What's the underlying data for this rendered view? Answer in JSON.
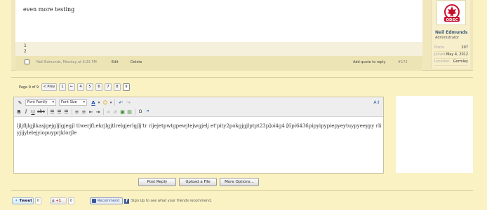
{
  "post": {
    "message": "even more testing",
    "code_lines": [
      "1",
      "2"
    ],
    "author_time": "Neil Edmunds, Monday at 6:23 PM",
    "edit_label": "Edit",
    "delete_label": "Delete",
    "quote_label": "Add quote to reply",
    "post_number": "#172"
  },
  "author": {
    "avatar_text": "ODSC",
    "name": "Neil Edmunds",
    "role": "Administrator",
    "stats": [
      {
        "label": "Posts:",
        "value": "207"
      },
      {
        "label": "Joined:",
        "value": "May 4, 2012"
      },
      {
        "label": "Location:",
        "value": "Gormley"
      }
    ]
  },
  "pagination": {
    "label": "Page 9 of 9",
    "prev": "< Prev",
    "first": "1",
    "ellipsis": "←",
    "pages": [
      "4",
      "5",
      "6",
      "7",
      "8",
      "9"
    ],
    "current": "9"
  },
  "editor": {
    "font_family": "Font Family",
    "font_size": "Font Size",
    "content": "ljljfljlgjlkasjgejgljlgjegjl tlwerjfl;ekrjlgjtlrelgjerlgjlj'tr rijejetpwtgpewjtejwgjelj et'pity2pokgjgjlptpt23p]oi4g4 [6pi6436pipyipypiepyeytuypyeeypy rliyjijylelejyiopuyprjklorjle"
  },
  "buttons": {
    "post_reply": "Post Reply",
    "upload_file": "Upload a File",
    "more_options": "More Options..."
  },
  "social": {
    "tweet": "Tweet",
    "tweet_count": "0",
    "gplus": "+1",
    "gplus_count": "0",
    "recommend": "Recommend",
    "signup": "Sign Up to see what your friends recommend."
  },
  "colors": {
    "background": "#fbf2c4",
    "author_name": "#3b5a7a",
    "facebook": "#3b5998"
  }
}
